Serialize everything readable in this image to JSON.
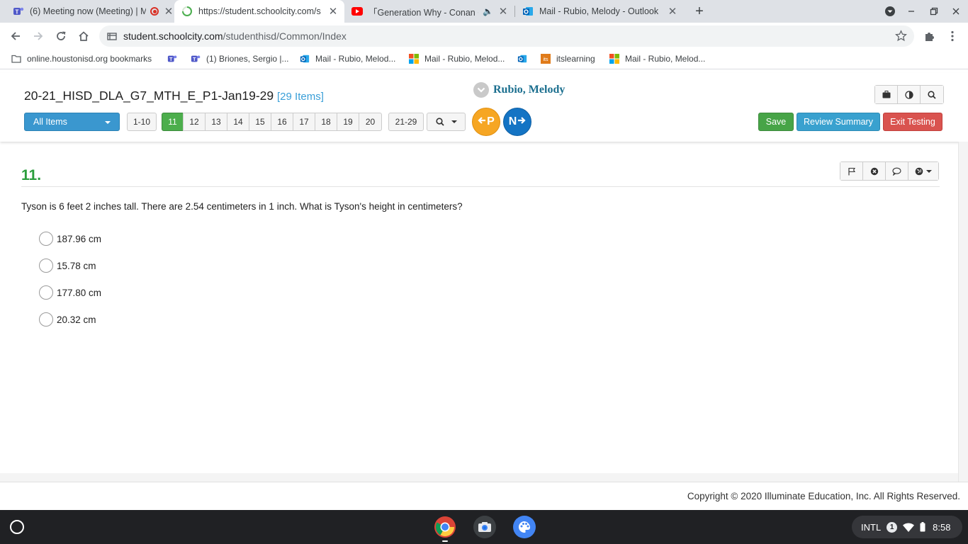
{
  "browser": {
    "tabs": [
      {
        "title": "(6) Meeting now (Meeting) | M",
        "icon": "teams-icon"
      },
      {
        "title": "https://student.schoolcity.com/s",
        "icon": "loading-icon",
        "active": true
      },
      {
        "title": "「Generation Why - Conan G",
        "icon": "youtube-icon"
      },
      {
        "title": "Mail - Rubio, Melody - Outlook",
        "icon": "outlook-icon"
      }
    ],
    "new_tab_label": "+",
    "url_host": "student.schoolcity.com",
    "url_path": "/studenthisd/Common/Index",
    "bookmarks": [
      {
        "label": "online.houstonisd.org bookmarks",
        "icon": "folder-icon"
      },
      {
        "label": "",
        "icon": "teams-icon"
      },
      {
        "label": "(1) Briones, Sergio |...",
        "icon": "teams-icon"
      },
      {
        "label": "Mail - Rubio, Melod...",
        "icon": "outlook-icon"
      },
      {
        "label": "Mail - Rubio, Melod...",
        "icon": "microsoft-icon"
      },
      {
        "label": "",
        "icon": "outlook-icon"
      },
      {
        "label": "itslearning",
        "icon": "itslearning-icon"
      },
      {
        "label": "Mail - Rubio, Melod...",
        "icon": "microsoft-icon"
      }
    ]
  },
  "header": {
    "test_title": "20-21_HISD_DLA_G7_MTH_E_P1-Jan19-29",
    "item_count": "[29 Items]",
    "student_name": "Rubio, Melody",
    "filter_label": "All Items",
    "pages": [
      "1-10",
      "11",
      "12",
      "13",
      "14",
      "15",
      "16",
      "17",
      "18",
      "19",
      "20",
      "21-29"
    ],
    "active_page": "11",
    "prev_label": "P",
    "next_label": "N",
    "save_label": "Save",
    "review_label": "Review Summary",
    "exit_label": "Exit Testing"
  },
  "question": {
    "number": "11.",
    "text": "Tyson is 6 feet 2 inches tall. There are 2.54 centimeters in 1 inch. What is Tyson's height in centimeters?",
    "choices": [
      "187.96 cm",
      "15.78 cm",
      "177.80 cm",
      "20.32 cm"
    ]
  },
  "footer": {
    "copyright": "Copyright © 2020 Illuminate Education, Inc. All Rights Reserved."
  },
  "shelf": {
    "keyboard": "INTL",
    "notifications": "1",
    "time": "8:58"
  },
  "colors": {
    "active_page": "#4cae4c",
    "primary": "#3a97cf",
    "danger": "#d9534f",
    "question_number": "#2a9d3c",
    "student_name": "#1a6e8e"
  }
}
